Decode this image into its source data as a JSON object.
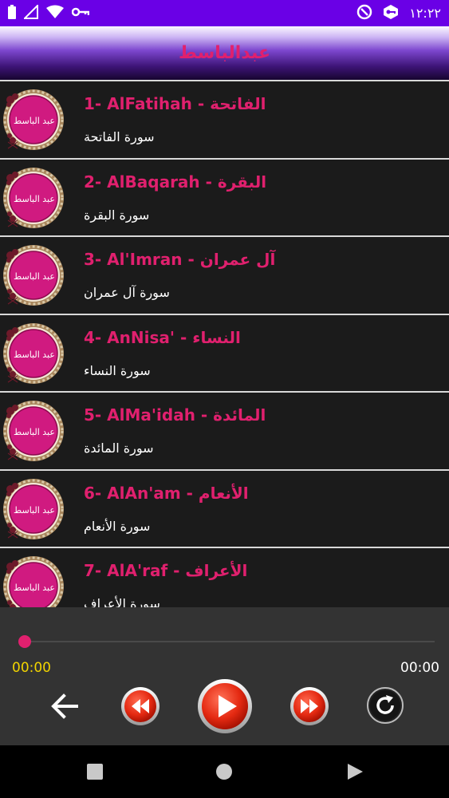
{
  "status_bar": {
    "time": "١٢:٢٢",
    "left_icons": [
      "battery-icon",
      "signal-icon",
      "wifi-icon",
      "vpn-key-icon"
    ],
    "right_icons": [
      "data-saver-icon",
      "key-badge-icon"
    ]
  },
  "header": {
    "title": "عبدالباسط"
  },
  "avatar_text": "عبد الباسط",
  "surahs": [
    {
      "title": "1- AlFatihah - الفاتحة",
      "subtitle": "سورة الفاتحة"
    },
    {
      "title": "2- AlBaqarah - البقرة",
      "subtitle": "سورة البقرة"
    },
    {
      "title": "3- Al'Imran - آل عمران",
      "subtitle": "سورة آل عمران"
    },
    {
      "title": "4- AnNisa' - النساء",
      "subtitle": "سورة النساء"
    },
    {
      "title": "5- AlMa'idah - المائدة",
      "subtitle": "سورة المائدة"
    },
    {
      "title": "6- AlAn'am - الأنعام",
      "subtitle": "سورة الأنعام"
    },
    {
      "title": "7- AlA'raf - الأعراف",
      "subtitle": "سورة الأعراف"
    }
  ],
  "player": {
    "current_time": "00:00",
    "total_time": "00:00",
    "progress": 0
  },
  "colors": {
    "accent": "#e0206e",
    "status_bar": "#6a00e6",
    "current_time": "#f2d400",
    "player_bg": "#333333",
    "list_bg": "#1b1b1b"
  }
}
